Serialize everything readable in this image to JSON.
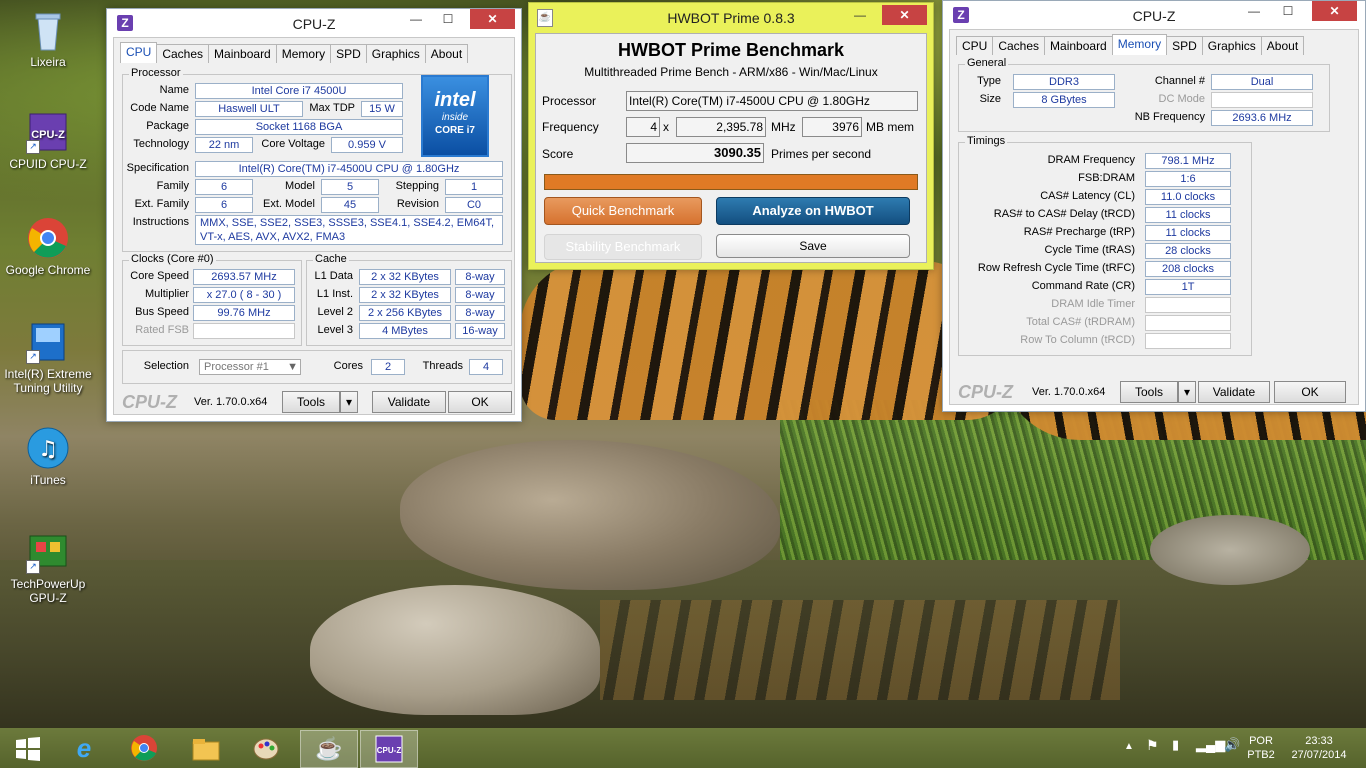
{
  "desktop": {
    "icons": [
      {
        "label": "Lixeira",
        "icon": "recycle-bin-icon"
      },
      {
        "label": "CPUID CPU-Z",
        "icon": "cpuz-icon"
      },
      {
        "label": "Google Chrome",
        "icon": "chrome-icon"
      },
      {
        "label": "Intel(R) Extreme Tuning Utility",
        "icon": "intel-xtu-icon"
      },
      {
        "label": "iTunes",
        "icon": "itunes-icon"
      },
      {
        "label": "TechPowerUp GPU-Z",
        "icon": "gpuz-icon"
      }
    ]
  },
  "cpuz_left": {
    "title": "CPU-Z",
    "tabs": [
      "CPU",
      "Caches",
      "Mainboard",
      "Memory",
      "SPD",
      "Graphics",
      "About"
    ],
    "active_tab": "CPU",
    "processor": {
      "group_title": "Processor",
      "name_label": "Name",
      "name": "Intel Core i7 4500U",
      "codename_label": "Code Name",
      "codename": "Haswell ULT",
      "maxtdp_label": "Max TDP",
      "maxtdp": "15 W",
      "package_label": "Package",
      "package": "Socket 1168 BGA",
      "technology_label": "Technology",
      "technology": "22 nm",
      "corevoltage_label": "Core Voltage",
      "corevoltage": "0.959 V",
      "spec_label": "Specification",
      "spec": "Intel(R) Core(TM) i7-4500U CPU @ 1.80GHz",
      "family_label": "Family",
      "family": "6",
      "model_label": "Model",
      "model": "5",
      "stepping_label": "Stepping",
      "stepping": "1",
      "extfamily_label": "Ext. Family",
      "extfamily": "6",
      "extmodel_label": "Ext. Model",
      "extmodel": "45",
      "revision_label": "Revision",
      "revision": "C0",
      "instructions_label": "Instructions",
      "instructions_line1": "MMX, SSE, SSE2, SSE3, SSSE3, SSE4.1, SSE4.2, EM64T,",
      "instructions_line2": "VT-x, AES, AVX, AVX2, FMA3"
    },
    "intel_logo": {
      "brand": "intel",
      "inside": "inside",
      "core": "CORE i7"
    },
    "clocks": {
      "group_title": "Clocks (Core #0)",
      "corespeed_label": "Core Speed",
      "corespeed": "2693.57 MHz",
      "multiplier_label": "Multiplier",
      "multiplier": "x 27.0 ( 8 - 30 )",
      "busspeed_label": "Bus Speed",
      "busspeed": "99.76 MHz",
      "ratedfsb_label": "Rated FSB",
      "ratedfsb": ""
    },
    "cache": {
      "group_title": "Cache",
      "rows": [
        {
          "label": "L1 Data",
          "size": "2 x 32 KBytes",
          "way": "8-way"
        },
        {
          "label": "L1 Inst.",
          "size": "2 x 32 KBytes",
          "way": "8-way"
        },
        {
          "label": "Level 2",
          "size": "2 x 256 KBytes",
          "way": "8-way"
        },
        {
          "label": "Level 3",
          "size": "4 MBytes",
          "way": "16-way"
        }
      ]
    },
    "selection_label": "Selection",
    "selection": "Processor #1",
    "cores_label": "Cores",
    "cores": "2",
    "threads_label": "Threads",
    "threads": "4",
    "logo": "CPU-Z",
    "version": "Ver. 1.70.0.x64",
    "tools": "Tools",
    "validate": "Validate",
    "ok": "OK"
  },
  "hwbot": {
    "title": "HWBOT Prime 0.8.3",
    "heading": "HWBOT Prime Benchmark",
    "subheading": "Multithreaded Prime Bench - ARM/x86 - Win/Mac/Linux",
    "processor_label": "Processor",
    "processor": "Intel(R) Core(TM) i7-4500U CPU @ 1.80GHz",
    "frequency_label": "Frequency",
    "threads": "4",
    "x": "x",
    "frequency": "2,395.78",
    "mhz": "MHz",
    "memory": "3976",
    "mbmem": "MB mem",
    "score_label": "Score",
    "score": "3090.35",
    "score_unit": "Primes per second",
    "progress": 1.0,
    "quick": "Quick Benchmark",
    "analyze": "Analyze on HWBOT",
    "stability": "Stability Benchmark",
    "save": "Save"
  },
  "cpuz_right": {
    "title": "CPU-Z",
    "tabs": [
      "CPU",
      "Caches",
      "Mainboard",
      "Memory",
      "SPD",
      "Graphics",
      "About"
    ],
    "active_tab": "Memory",
    "general": {
      "group_title": "General",
      "type_label": "Type",
      "type": "DDR3",
      "channel_label": "Channel #",
      "channel": "Dual",
      "size_label": "Size",
      "size": "8 GBytes",
      "dcmode_label": "DC Mode",
      "dcmode": "",
      "nbfreq_label": "NB Frequency",
      "nbfreq": "2693.6 MHz"
    },
    "timings": {
      "group_title": "Timings",
      "rows": [
        {
          "label": "DRAM Frequency",
          "value": "798.1 MHz",
          "grey": false
        },
        {
          "label": "FSB:DRAM",
          "value": "1:6",
          "grey": false
        },
        {
          "label": "CAS# Latency (CL)",
          "value": "11.0 clocks",
          "grey": false
        },
        {
          "label": "RAS# to CAS# Delay (tRCD)",
          "value": "11 clocks",
          "grey": false
        },
        {
          "label": "RAS# Precharge (tRP)",
          "value": "11 clocks",
          "grey": false
        },
        {
          "label": "Cycle Time (tRAS)",
          "value": "28 clocks",
          "grey": false
        },
        {
          "label": "Row Refresh Cycle Time (tRFC)",
          "value": "208 clocks",
          "grey": false
        },
        {
          "label": "Command Rate (CR)",
          "value": "1T",
          "grey": false
        },
        {
          "label": "DRAM Idle Timer",
          "value": "",
          "grey": true
        },
        {
          "label": "Total CAS# (tRDRAM)",
          "value": "",
          "grey": true
        },
        {
          "label": "Row To Column (tRCD)",
          "value": "",
          "grey": true
        }
      ]
    },
    "logo": "CPU-Z",
    "version": "Ver. 1.70.0.x64",
    "tools": "Tools",
    "validate": "Validate",
    "ok": "OK"
  },
  "taskbar": {
    "items": [
      "start-icon",
      "internet-explorer-icon",
      "chrome-icon",
      "file-explorer-icon",
      "paint-icon",
      "java-icon",
      "cpuz-icon"
    ],
    "lang_top": "POR",
    "lang_bottom": "PTB2",
    "time": "23:33",
    "date": "27/07/2014"
  }
}
